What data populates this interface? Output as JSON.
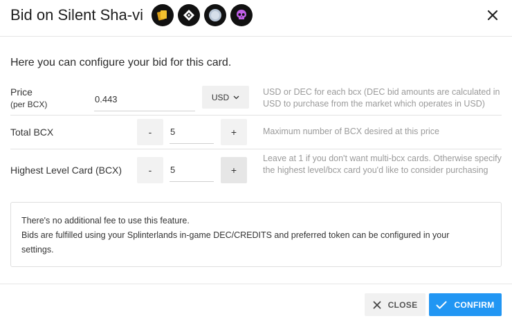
{
  "dialog": {
    "title": "Bid on Silent Sha-vi",
    "intro": "Here you can configure your bid for this card.",
    "badges": [
      {
        "icon": "card-icon",
        "color": "#f2c12e"
      },
      {
        "icon": "diamond-icon",
        "color": "#ffffff"
      },
      {
        "icon": "neutral-orb-icon",
        "color": "#b9c6d6"
      },
      {
        "icon": "skull-icon",
        "color": "#c060e8"
      }
    ]
  },
  "price": {
    "label": "Price",
    "sublabel": "(per BCX)",
    "value": "0.443",
    "currency": "USD",
    "help": "USD or DEC for each bcx (DEC bid amounts are calculated in USD to purchase from the market which operates in USD)"
  },
  "total_bcx": {
    "label": "Total BCX",
    "minus": "-",
    "plus": "+",
    "value": "5",
    "help": "Maximum number of BCX desired at this price"
  },
  "highest_level": {
    "label": "Highest Level Card (BCX)",
    "minus": "-",
    "plus": "+",
    "value": "5",
    "help": "Leave at 1 if you don't want multi-bcx cards. Otherwise specify the highest level/bcx card you'd like to consider purchasing"
  },
  "notice": {
    "line1": "There's no additional fee to use this feature.",
    "line2": "Bids are fulfilled using your Splinterlands in-game DEC/CREDITS and preferred token can be configured in your",
    "line3": "settings."
  },
  "footer": {
    "close_label": "CLOSE",
    "confirm_label": "CONFIRM"
  },
  "colors": {
    "accent": "#2196f3",
    "help_text": "#9a9a9a"
  }
}
